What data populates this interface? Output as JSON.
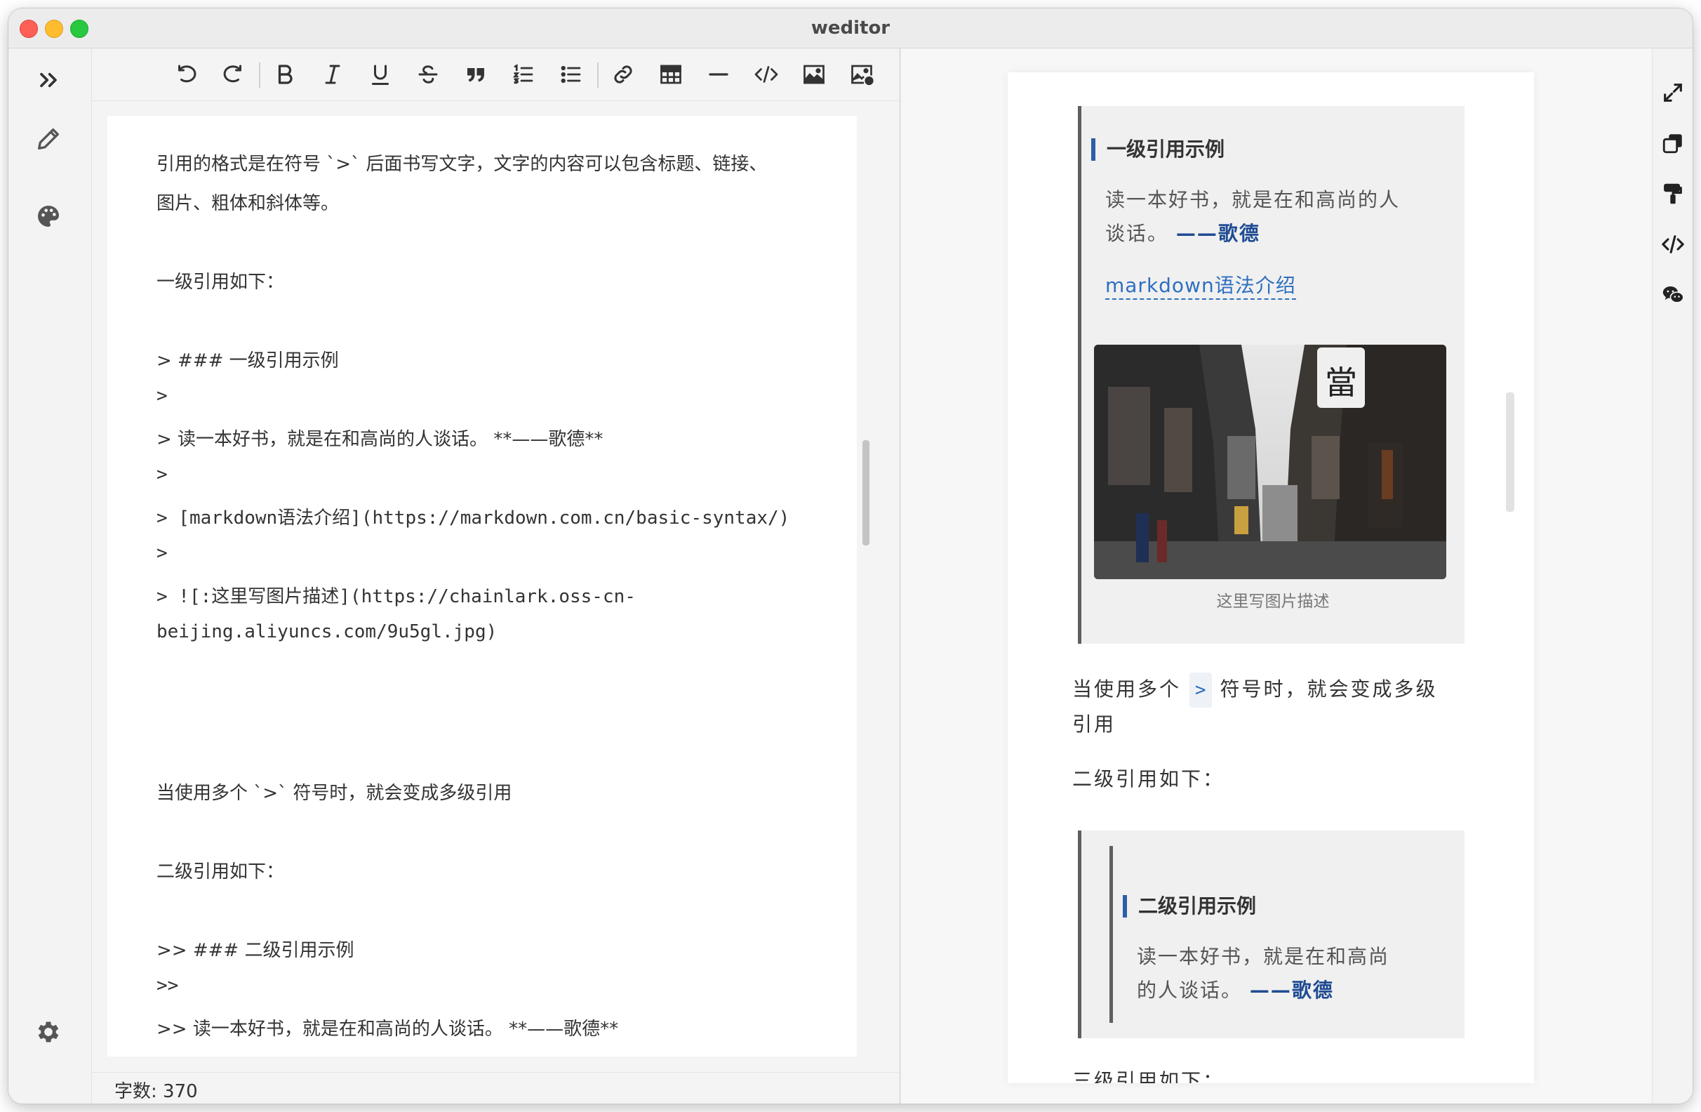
{
  "window": {
    "title": "weditor"
  },
  "left_rail": {
    "expand_icon": "double-chevron-right-icon",
    "items": [
      "pencil-icon",
      "palette-icon"
    ],
    "settings_icon": "gear-icon"
  },
  "toolbar": {
    "buttons": [
      "undo",
      "redo",
      "bold",
      "italic",
      "underline",
      "strikethrough",
      "quote",
      "ordered-list",
      "unordered-list",
      "link",
      "table",
      "horizontal-rule",
      "code",
      "image",
      "image-upload"
    ]
  },
  "editor": {
    "lines": [
      "引用的格式是在符号 `>` 后面书写文字，文字的内容可以包含标题、链接、",
      "图片、粗体和斜体等。",
      "一级引用如下：",
      "> ### 一级引用示例",
      ">",
      "> 读一本好书，就是在和高尚的人谈话。 **——歌德**",
      ">",
      "> [markdown语法介绍](https://markdown.com.cn/basic-syntax/)",
      ">",
      "> ![:这里写图片描述](https://chainlark.oss-cn-",
      "beijing.aliyuncs.com/9u5gl.jpg)",
      "当使用多个 `>` 符号时，就会变成多级引用",
      "二级引用如下：",
      ">> ### 二级引用示例",
      ">>",
      ">> 读一本好书，就是在和高尚的人谈话。 **——歌德**"
    ]
  },
  "status": {
    "word_count": "字数: 370"
  },
  "preview": {
    "quote1": {
      "heading": "一级引用示例",
      "text_line1": "读一本好书，就是在和高尚的人",
      "text_line2": "谈话。",
      "author": "——歌德",
      "link": "markdown语法介绍",
      "caption": "这里写图片描述"
    },
    "para1_before": "当使用多个",
    "para1_code": ">",
    "para1_after": "符号时，就会变成多级",
    "para1_line2": "引用",
    "para2": "二级引用如下：",
    "quote2": {
      "heading": "二级引用示例",
      "text_line1": "读一本好书，就是在和高尚",
      "text_line2": "的人谈话。",
      "author": "——歌德"
    },
    "para3_partial": "三级引用如下："
  },
  "right_rail": {
    "items": [
      "fullscreen-icon",
      "copy-icon",
      "format-painter-icon",
      "code-icon",
      "wechat-icon"
    ]
  },
  "colors": {
    "accent": "#2d5fa8",
    "link": "#2d6fc0",
    "quote_bg": "#f0f0f0",
    "quote_border": "#5f5f5f"
  }
}
